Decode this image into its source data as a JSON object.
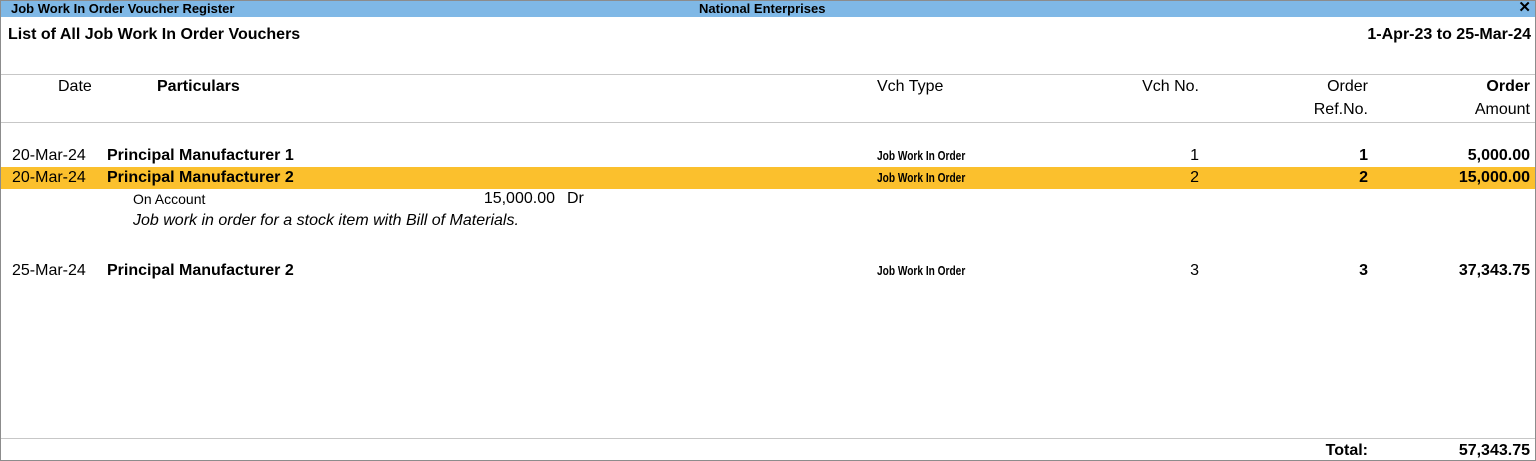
{
  "window": {
    "title": "Job Work In Order Voucher Register",
    "company": "National Enterprises",
    "close_glyph": "✕"
  },
  "report": {
    "title": "List of All Job Work In Order Vouchers",
    "period": "1-Apr-23 to 25-Mar-24"
  },
  "columns": {
    "date": "Date",
    "particulars": "Particulars",
    "vch_type": "Vch Type",
    "vch_no": "Vch No.",
    "order_ref_1": "Order",
    "order_ref_2": "Ref.No.",
    "order_amount_1": "Order",
    "order_amount_2": "Amount"
  },
  "rows": [
    {
      "date": "20-Mar-24",
      "particulars": "Principal Manufacturer 1",
      "vch_type": "Job Work In Order",
      "vch_no": "1",
      "order_ref": "1",
      "amount": "5,000.00",
      "selected": false
    },
    {
      "date": "20-Mar-24",
      "particulars": "Principal Manufacturer 2",
      "vch_type": "Job Work In Order",
      "vch_no": "2",
      "order_ref": "2",
      "amount": "15,000.00",
      "selected": true,
      "detail": {
        "ledger": "On Account",
        "amount": "15,000.00",
        "drcr": "Dr",
        "narration": "Job work in order for a stock item with Bill of Materials."
      }
    },
    {
      "date": "25-Mar-24",
      "particulars": "Principal Manufacturer 2",
      "vch_type": "Job Work In Order",
      "vch_no": "3",
      "order_ref": "3",
      "amount": "37,343.75",
      "selected": false
    }
  ],
  "total": {
    "label": "Total:",
    "amount": "57,343.75"
  },
  "colors": {
    "titlebar": "#7fb8e6",
    "selected_row": "#fbc02d"
  }
}
